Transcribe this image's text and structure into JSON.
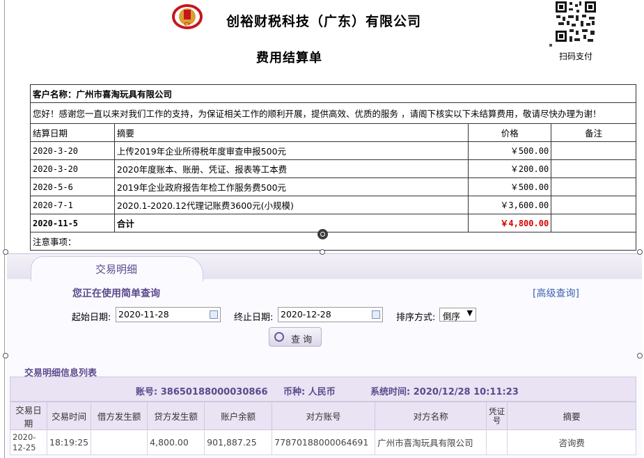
{
  "header": {
    "company": "创裕财税科技（广东）有限公司",
    "title": "费用结算单",
    "qr_label": "扫码支付",
    "logo_text": "CY"
  },
  "bill": {
    "customer_label": "客户名称：",
    "customer_name": "广州市喜淘玩具有限公司",
    "greeting": "您好！感谢您一直以来对我们工作的支持，为保证相关工作的顺利开展，提供高效、优质的服务 ，请阁下核实以下未结算费用，敬请尽快办理为谢！",
    "columns": [
      "结算日期",
      "摘要",
      "价格",
      "备注"
    ],
    "rows": [
      {
        "date": "2020-3-20",
        "summary": "上传2019年企业所得税年度审查申报500元",
        "price": "￥500.00",
        "note": ""
      },
      {
        "date": "2020-3-20",
        "summary": "2020年度账本、账册、凭证、报表等工本费",
        "price": "￥200.00",
        "note": ""
      },
      {
        "date": "2020-5-6",
        "summary": "2019年企业政府报告年检工作服务费500元",
        "price": "￥500.00",
        "note": ""
      },
      {
        "date": "2020-7-1",
        "summary": "2020.1-2020.12代理记账费3600元(小规模)",
        "price": "￥3,600.00",
        "note": ""
      }
    ],
    "total": {
      "date": "2020-11-5",
      "label": "合计",
      "amount": "￥4,800.00"
    },
    "notes_label": "注意事项："
  },
  "bank": {
    "tab": "交易明细",
    "simple_query": "您正在使用简单查询",
    "advanced_query": "[高级查询]",
    "start_label": "起始日期:",
    "start_date": "2020-11-28",
    "end_label": "终止日期:",
    "end_date": "2020-12-28",
    "sort_label": "排序方式:",
    "sort_value": "倒序",
    "query_button": "查 询",
    "list_title": "交易明细信息列表",
    "account_info": "账号: 38650188000030866",
    "currency_info": "币种: 人民币",
    "system_time": "系统时间: 2020/12/28 10:11:23",
    "columns": [
      "交易日期",
      "交易时间",
      "借方发生额",
      "贷方发生额",
      "账户余额",
      "对方账号",
      "对方名称",
      "凭证号",
      "摘要"
    ],
    "rows": [
      {
        "date": "2020-12-25",
        "time": "18:19:25",
        "debit": "",
        "credit": "4,800.00",
        "balance": "901,887.25",
        "counter_account": "77870188000064691",
        "counter_name": "广州市喜淘玩具有限公司",
        "voucher": "",
        "summary": "咨询费"
      }
    ]
  },
  "colors": {
    "accent": "#5a4a8c",
    "total_red": "#d40000",
    "bank_header_bg": "#e9e3f4",
    "logo_red": "#c8151d",
    "logo_gold": "#d9a030"
  }
}
